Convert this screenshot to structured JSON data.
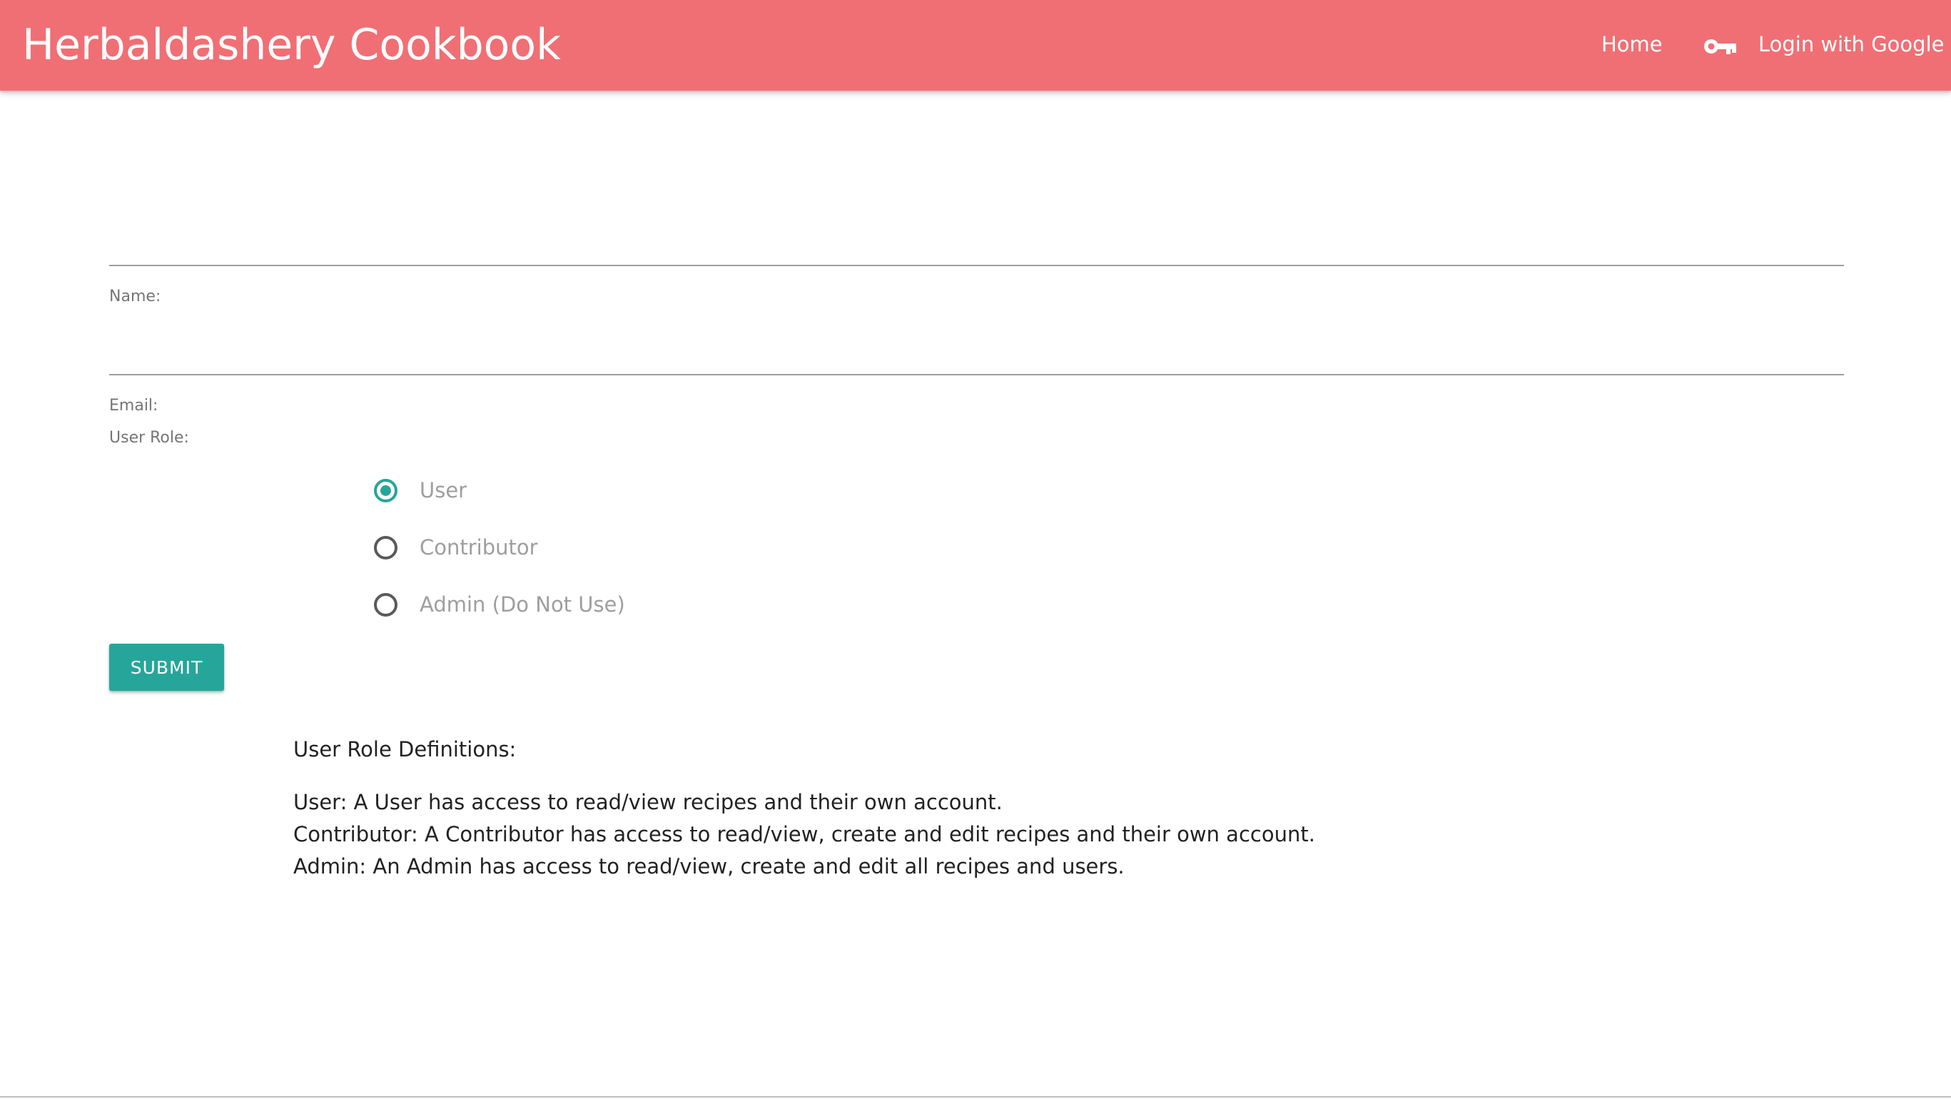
{
  "app": {
    "title": "Herbaldashery Cookbook",
    "accent_color": "#f06f74",
    "button_color": "#26a69a"
  },
  "nav": {
    "home": "Home",
    "login_icon": "key-icon",
    "login": "Login with Google"
  },
  "form": {
    "name_field": {
      "label": "Name:",
      "value": ""
    },
    "email_field": {
      "label": "Email:",
      "value": ""
    },
    "role_label": "User Role:",
    "roles": [
      {
        "label": "User",
        "checked": true
      },
      {
        "label": "Contributor",
        "checked": false
      },
      {
        "label": "Admin (Do Not Use)",
        "checked": false
      }
    ],
    "submit": "SUBMIT"
  },
  "definitions": {
    "title": "User Role Definitions:",
    "lines": [
      "User: A User has access to read/view recipes and their own account.",
      "Contributor: A Contributor has access to read/view, create and edit recipes and their own account.",
      "Admin: An Admin has access to read/view, create and edit all recipes and users."
    ]
  }
}
